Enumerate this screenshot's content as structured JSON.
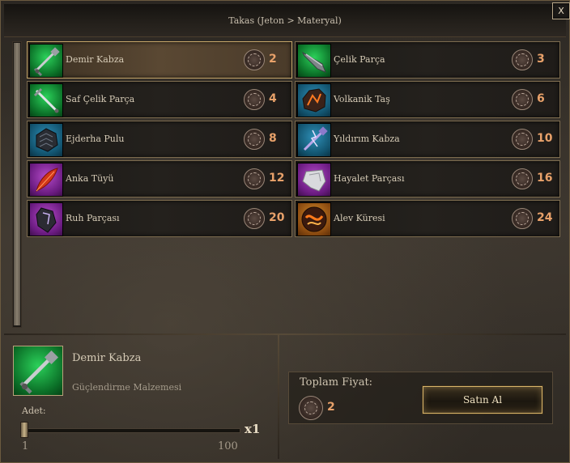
{
  "window": {
    "title": "Takas (Jeton > Materyal)",
    "close_label": "X"
  },
  "items": [
    {
      "name": "Demir Kabza",
      "price": "2",
      "icon": "iron-hilt-icon",
      "bg": "green",
      "selected": true
    },
    {
      "name": "Çelik Parça",
      "price": "3",
      "icon": "steel-piece-icon",
      "bg": "green",
      "selected": false
    },
    {
      "name": "Saf Çelik Parça",
      "price": "4",
      "icon": "pure-steel-piece-icon",
      "bg": "green",
      "selected": false
    },
    {
      "name": "Volkanik Taş",
      "price": "6",
      "icon": "volcanic-stone-icon",
      "bg": "blue",
      "selected": false
    },
    {
      "name": "Ejderha Pulu",
      "price": "8",
      "icon": "dragon-scale-icon",
      "bg": "blue",
      "selected": false
    },
    {
      "name": "Yıldırım Kabza",
      "price": "10",
      "icon": "lightning-hilt-icon",
      "bg": "blue",
      "selected": false
    },
    {
      "name": "Anka Tüyü",
      "price": "12",
      "icon": "phoenix-feather-icon",
      "bg": "purple",
      "selected": false
    },
    {
      "name": "Hayalet Parçası",
      "price": "16",
      "icon": "ghost-fragment-icon",
      "bg": "purple",
      "selected": false
    },
    {
      "name": "Ruh Parçası",
      "price": "20",
      "icon": "soul-fragment-icon",
      "bg": "purple",
      "selected": false
    },
    {
      "name": "Alev Küresi",
      "price": "24",
      "icon": "flame-orb-icon",
      "bg": "orange",
      "selected": false
    }
  ],
  "detail": {
    "name": "Demir Kabza",
    "type": "Güçlendirme Malzemesi",
    "icon": "iron-hilt-icon"
  },
  "quantity": {
    "label": "Adet:",
    "value": 1,
    "value_text": "x1",
    "min": "1",
    "max": "100"
  },
  "total": {
    "label": "Toplam Fiyat:",
    "value": "2"
  },
  "buy_button": {
    "label": "Satın Al"
  },
  "colors": {
    "price": "#e8a16a",
    "selected_border": "#c7a76a",
    "accent_gold": "#d9b56a"
  }
}
